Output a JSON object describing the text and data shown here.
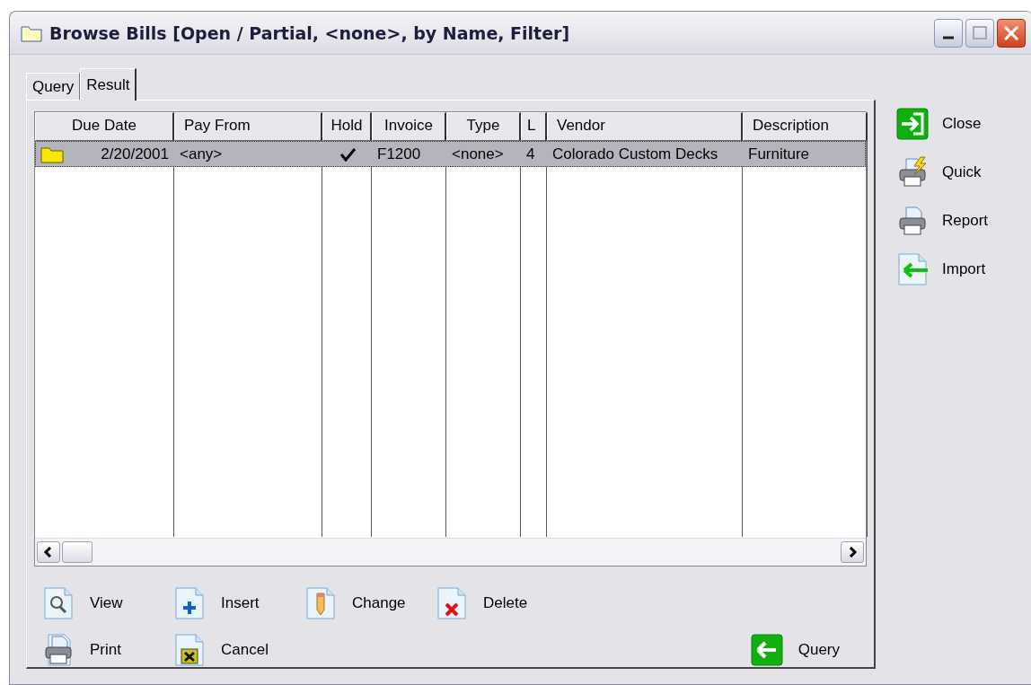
{
  "window": {
    "title": "Browse Bills [Open / Partial, <none>, by Name, Filter]"
  },
  "tabs": [
    {
      "label": "Query",
      "selected": false
    },
    {
      "label": "Result",
      "selected": true
    }
  ],
  "table": {
    "columns": [
      "Due Date",
      "Pay From",
      "Hold",
      "Invoice",
      "Type",
      "L",
      "Vendor",
      "Description"
    ],
    "rows": [
      {
        "selected": true,
        "due_date": "2/20/2001",
        "pay_from": "<any>",
        "hold": true,
        "invoice": "F1200",
        "type": "<none>",
        "column_6": "4",
        "vendor": "Colorado Custom Decks",
        "description": "Furniture"
      }
    ]
  },
  "actions": [
    {
      "kind": "view",
      "label": "View"
    },
    {
      "kind": "insert",
      "label": "Insert"
    },
    {
      "kind": "change",
      "label": "Change"
    },
    {
      "kind": "delete",
      "label": "Delete"
    },
    {
      "kind": "print",
      "label": "Print"
    },
    {
      "kind": "cancel",
      "label": "Cancel"
    },
    {
      "kind": "query",
      "label": "Query"
    }
  ],
  "sidebar": {
    "items": [
      {
        "kind": "close",
        "label": "Close"
      },
      {
        "kind": "quick",
        "label": "Quick"
      },
      {
        "kind": "report",
        "label": "Report"
      },
      {
        "kind": "import",
        "label": "Import"
      }
    ]
  }
}
